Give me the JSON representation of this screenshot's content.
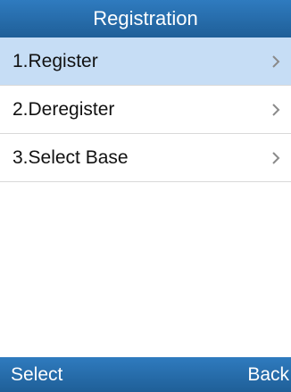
{
  "header": {
    "title": "Registration"
  },
  "menu": {
    "items": [
      {
        "label": "1.Register",
        "selected": true,
        "icon": "chevron-right-icon"
      },
      {
        "label": "2.Deregister",
        "selected": false,
        "icon": "chevron-right-icon"
      },
      {
        "label": "3.Select Base",
        "selected": false,
        "icon": "chevron-right-icon"
      }
    ]
  },
  "softkeys": {
    "left_label": "Select",
    "right_label": "Back"
  },
  "colors": {
    "bar_top": "#2f7bbf",
    "bar_bottom": "#1f5f98",
    "selection": "#c6ddf5",
    "divider": "#d9d9d9"
  }
}
